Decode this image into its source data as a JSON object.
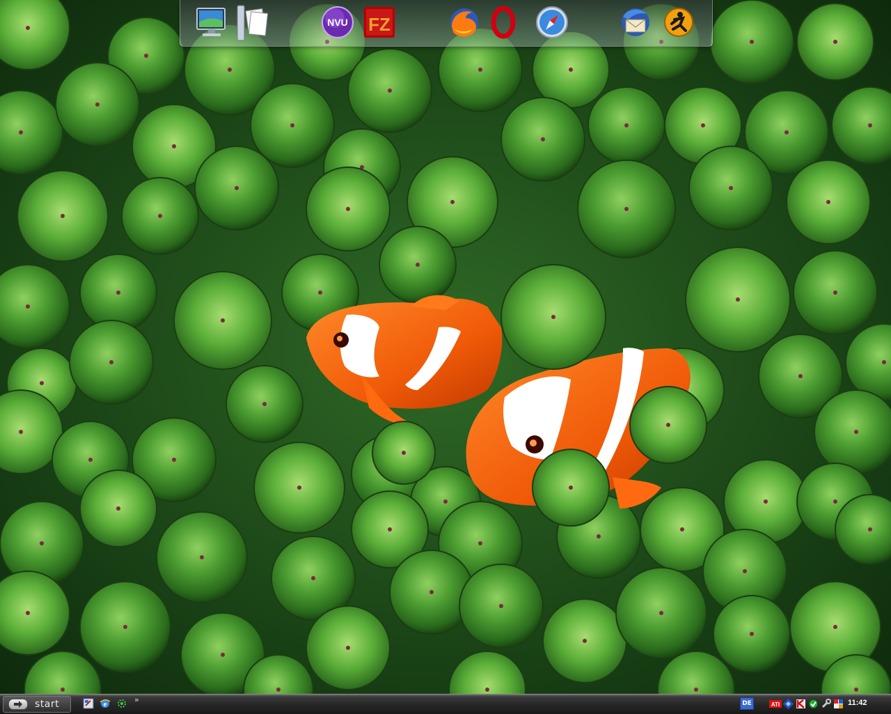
{
  "desktop": {
    "wallpaper": "clownfish-anemone"
  },
  "dock": {
    "items": [
      {
        "name": "my-computer",
        "icon": "monitor-icon"
      },
      {
        "name": "documents",
        "icon": "documents-icon"
      },
      {
        "name": "nvu",
        "icon": "nvu-icon",
        "label": "NVU"
      },
      {
        "name": "filezilla",
        "icon": "filezilla-icon",
        "label": "FZ"
      },
      {
        "name": "firefox",
        "icon": "firefox-icon"
      },
      {
        "name": "opera",
        "icon": "opera-icon"
      },
      {
        "name": "safari",
        "icon": "safari-icon"
      },
      {
        "name": "thunderbird",
        "icon": "thunderbird-icon"
      },
      {
        "name": "winamp-like",
        "icon": "orange-runner-icon"
      }
    ]
  },
  "taskbar": {
    "start_label": "start",
    "quick_launch": [
      "shortcut-icon",
      "ie-icon",
      "gear-icon"
    ],
    "more_label": "»",
    "language": "DE",
    "tray": [
      "ati-icon",
      "network-icon",
      "antivirus-icon",
      "green-status-icon",
      "wrench-icon",
      "shield-icon"
    ],
    "clock": "11:42"
  },
  "colors": {
    "taskbar_bg": "#262626",
    "accent_orange": "#ff6a10",
    "anemone_green": "#4a9a30"
  }
}
